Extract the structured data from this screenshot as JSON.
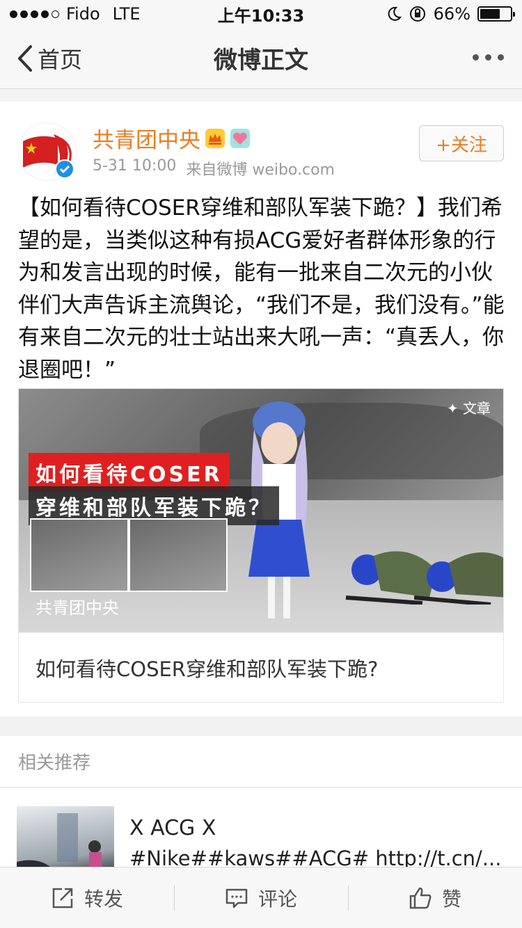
{
  "status_bar": {
    "carrier": "Fido",
    "network": "LTE",
    "time": "上午10:33",
    "battery_percent": "66%",
    "battery_level": 0.66,
    "icons": [
      "signal-icon",
      "moon-icon",
      "orientation-lock-icon",
      "battery-icon"
    ]
  },
  "nav": {
    "back_label": "首页",
    "title": "微博正文",
    "more_icon": "more-dots-icon"
  },
  "post": {
    "author": "共青团中央",
    "meta_time": "5-31 10:00",
    "meta_source": "来自微博 weibo.com",
    "follow_label": "+关注",
    "text": "【如何看待COSER穿维和部队军装下跪？】我们希望的是，当类似这种有损ACG爱好者群体形象的行为和发言出现的时候，能有一批来自二次元的小伙伴们大声告诉主流舆论，“我们不是，我们没有。”能有来自二次元的壮士站出来大吼一声：“真丢人，你退圈吧！”",
    "article": {
      "image_label": "文章",
      "overlay_line1": "如何看待COSER",
      "overlay_line2": "穿维和部队军装下跪？",
      "image_brand": "共青团中央",
      "title": "如何看待COSER穿维和部队军装下跪?"
    }
  },
  "related": {
    "header": "相关推荐",
    "items": [
      {
        "title": "X ACG X",
        "desc": "#Nike##kaws##ACG# http://t.cn/..."
      }
    ]
  },
  "toolbar": {
    "repost": "转发",
    "comment": "评论",
    "like": "赞"
  },
  "colors": {
    "brand_orange": "#f07b1e",
    "verified_blue": "#1e90e6",
    "overlay_red": "#e02020"
  }
}
